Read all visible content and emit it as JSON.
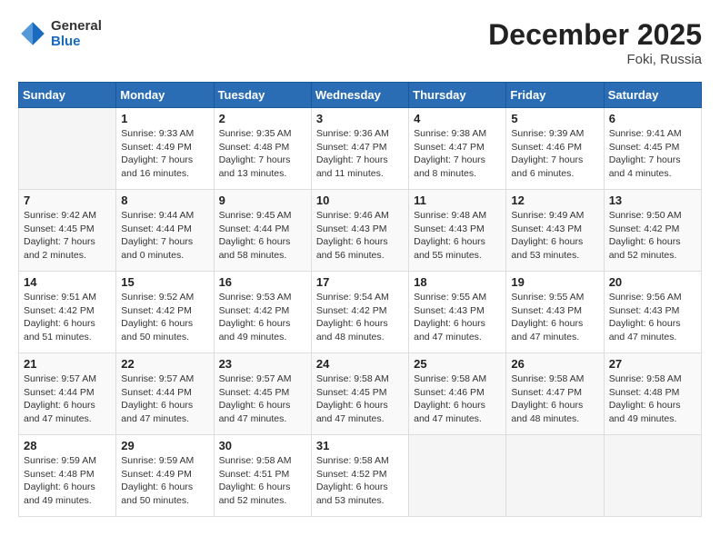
{
  "header": {
    "logo_general": "General",
    "logo_blue": "Blue",
    "month_title": "December 2025",
    "location": "Foki, Russia"
  },
  "weekdays": [
    "Sunday",
    "Monday",
    "Tuesday",
    "Wednesday",
    "Thursday",
    "Friday",
    "Saturday"
  ],
  "weeks": [
    [
      {
        "day": "",
        "info": ""
      },
      {
        "day": "1",
        "info": "Sunrise: 9:33 AM\nSunset: 4:49 PM\nDaylight: 7 hours\nand 16 minutes."
      },
      {
        "day": "2",
        "info": "Sunrise: 9:35 AM\nSunset: 4:48 PM\nDaylight: 7 hours\nand 13 minutes."
      },
      {
        "day": "3",
        "info": "Sunrise: 9:36 AM\nSunset: 4:47 PM\nDaylight: 7 hours\nand 11 minutes."
      },
      {
        "day": "4",
        "info": "Sunrise: 9:38 AM\nSunset: 4:47 PM\nDaylight: 7 hours\nand 8 minutes."
      },
      {
        "day": "5",
        "info": "Sunrise: 9:39 AM\nSunset: 4:46 PM\nDaylight: 7 hours\nand 6 minutes."
      },
      {
        "day": "6",
        "info": "Sunrise: 9:41 AM\nSunset: 4:45 PM\nDaylight: 7 hours\nand 4 minutes."
      }
    ],
    [
      {
        "day": "7",
        "info": "Sunrise: 9:42 AM\nSunset: 4:45 PM\nDaylight: 7 hours\nand 2 minutes."
      },
      {
        "day": "8",
        "info": "Sunrise: 9:44 AM\nSunset: 4:44 PM\nDaylight: 7 hours\nand 0 minutes."
      },
      {
        "day": "9",
        "info": "Sunrise: 9:45 AM\nSunset: 4:44 PM\nDaylight: 6 hours\nand 58 minutes."
      },
      {
        "day": "10",
        "info": "Sunrise: 9:46 AM\nSunset: 4:43 PM\nDaylight: 6 hours\nand 56 minutes."
      },
      {
        "day": "11",
        "info": "Sunrise: 9:48 AM\nSunset: 4:43 PM\nDaylight: 6 hours\nand 55 minutes."
      },
      {
        "day": "12",
        "info": "Sunrise: 9:49 AM\nSunset: 4:43 PM\nDaylight: 6 hours\nand 53 minutes."
      },
      {
        "day": "13",
        "info": "Sunrise: 9:50 AM\nSunset: 4:42 PM\nDaylight: 6 hours\nand 52 minutes."
      }
    ],
    [
      {
        "day": "14",
        "info": "Sunrise: 9:51 AM\nSunset: 4:42 PM\nDaylight: 6 hours\nand 51 minutes."
      },
      {
        "day": "15",
        "info": "Sunrise: 9:52 AM\nSunset: 4:42 PM\nDaylight: 6 hours\nand 50 minutes."
      },
      {
        "day": "16",
        "info": "Sunrise: 9:53 AM\nSunset: 4:42 PM\nDaylight: 6 hours\nand 49 minutes."
      },
      {
        "day": "17",
        "info": "Sunrise: 9:54 AM\nSunset: 4:42 PM\nDaylight: 6 hours\nand 48 minutes."
      },
      {
        "day": "18",
        "info": "Sunrise: 9:55 AM\nSunset: 4:43 PM\nDaylight: 6 hours\nand 47 minutes."
      },
      {
        "day": "19",
        "info": "Sunrise: 9:55 AM\nSunset: 4:43 PM\nDaylight: 6 hours\nand 47 minutes."
      },
      {
        "day": "20",
        "info": "Sunrise: 9:56 AM\nSunset: 4:43 PM\nDaylight: 6 hours\nand 47 minutes."
      }
    ],
    [
      {
        "day": "21",
        "info": "Sunrise: 9:57 AM\nSunset: 4:44 PM\nDaylight: 6 hours\nand 47 minutes."
      },
      {
        "day": "22",
        "info": "Sunrise: 9:57 AM\nSunset: 4:44 PM\nDaylight: 6 hours\nand 47 minutes."
      },
      {
        "day": "23",
        "info": "Sunrise: 9:57 AM\nSunset: 4:45 PM\nDaylight: 6 hours\nand 47 minutes."
      },
      {
        "day": "24",
        "info": "Sunrise: 9:58 AM\nSunset: 4:45 PM\nDaylight: 6 hours\nand 47 minutes."
      },
      {
        "day": "25",
        "info": "Sunrise: 9:58 AM\nSunset: 4:46 PM\nDaylight: 6 hours\nand 47 minutes."
      },
      {
        "day": "26",
        "info": "Sunrise: 9:58 AM\nSunset: 4:47 PM\nDaylight: 6 hours\nand 48 minutes."
      },
      {
        "day": "27",
        "info": "Sunrise: 9:58 AM\nSunset: 4:48 PM\nDaylight: 6 hours\nand 49 minutes."
      }
    ],
    [
      {
        "day": "28",
        "info": "Sunrise: 9:59 AM\nSunset: 4:48 PM\nDaylight: 6 hours\nand 49 minutes."
      },
      {
        "day": "29",
        "info": "Sunrise: 9:59 AM\nSunset: 4:49 PM\nDaylight: 6 hours\nand 50 minutes."
      },
      {
        "day": "30",
        "info": "Sunrise: 9:58 AM\nSunset: 4:51 PM\nDaylight: 6 hours\nand 52 minutes."
      },
      {
        "day": "31",
        "info": "Sunrise: 9:58 AM\nSunset: 4:52 PM\nDaylight: 6 hours\nand 53 minutes."
      },
      {
        "day": "",
        "info": ""
      },
      {
        "day": "",
        "info": ""
      },
      {
        "day": "",
        "info": ""
      }
    ]
  ]
}
